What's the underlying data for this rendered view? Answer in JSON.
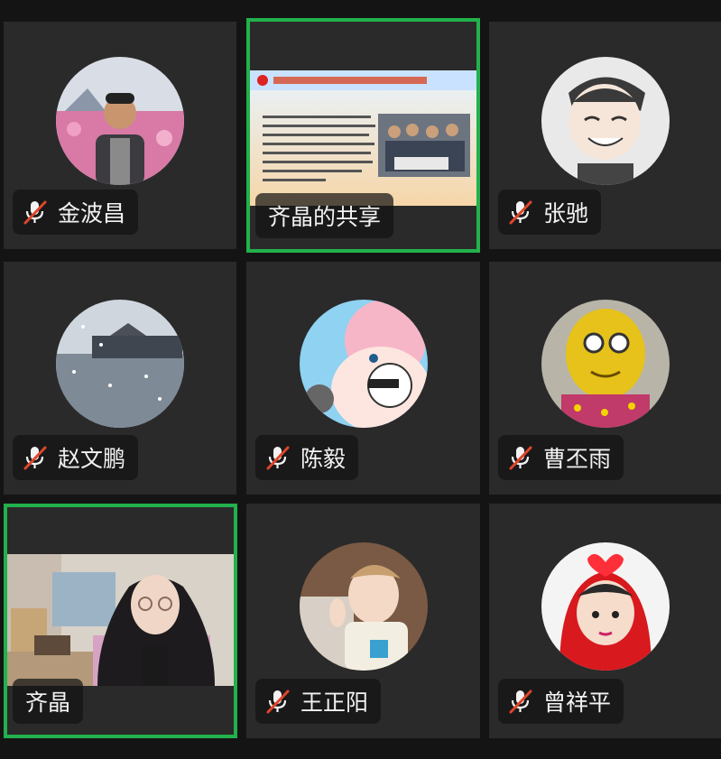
{
  "participants": [
    {
      "name": "金波昌",
      "muted": true
    },
    {
      "name": "齐晶的共享",
      "muted": false
    },
    {
      "name": "张驰",
      "muted": true
    },
    {
      "name": "赵文鹏",
      "muted": true
    },
    {
      "name": "陈毅",
      "muted": true
    },
    {
      "name": "曹丕雨",
      "muted": true
    },
    {
      "name": "齐晶",
      "muted": false
    },
    {
      "name": "王正阳",
      "muted": true
    },
    {
      "name": "曾祥平",
      "muted": true
    }
  ],
  "colors": {
    "active_border": "#22b14c",
    "muted_slash": "#e0452b",
    "tile_bg": "#2a2a2a"
  },
  "icons": {
    "muted": "mic-muted-icon"
  }
}
